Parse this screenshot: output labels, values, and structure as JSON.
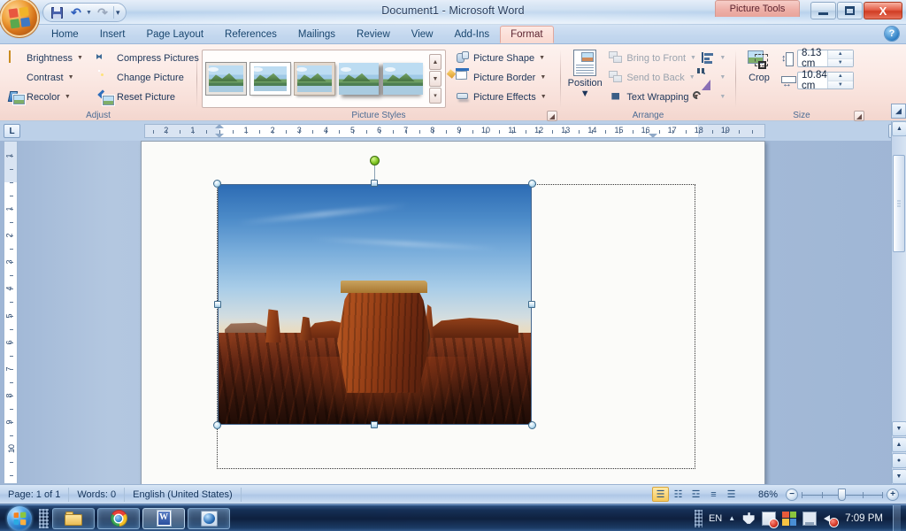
{
  "window": {
    "title": "Document1 - Microsoft Word",
    "contextual_tab_label": "Picture Tools",
    "minimize_label": "Minimize",
    "restore_label": "Restore",
    "close_label": "X",
    "help_label": "?"
  },
  "quick_access": {
    "office_button": "Office Button",
    "items": [
      {
        "name": "save",
        "label": "Save"
      },
      {
        "name": "undo",
        "label": "Undo"
      },
      {
        "name": "redo",
        "label": "Redo"
      },
      {
        "name": "customize",
        "label": "Customize Quick Access Toolbar"
      }
    ]
  },
  "tabs": [
    {
      "label": "Home",
      "active": false
    },
    {
      "label": "Insert",
      "active": false
    },
    {
      "label": "Page Layout",
      "active": false
    },
    {
      "label": "References",
      "active": false
    },
    {
      "label": "Mailings",
      "active": false
    },
    {
      "label": "Review",
      "active": false
    },
    {
      "label": "View",
      "active": false
    },
    {
      "label": "Add-Ins",
      "active": false
    },
    {
      "label": "Format",
      "active": true
    }
  ],
  "ribbon": {
    "groups": [
      {
        "name": "Adjust",
        "label": "Adjust",
        "commands": [
          {
            "label": "Brightness",
            "icon": "brightness-icon",
            "dropdown": true,
            "disabled": false
          },
          {
            "label": "Contrast",
            "icon": "contrast-icon",
            "dropdown": true,
            "disabled": false
          },
          {
            "label": "Recolor",
            "icon": "recolor-icon",
            "dropdown": true,
            "disabled": false
          },
          {
            "label": "Compress Pictures",
            "icon": "compress-pictures-icon",
            "dropdown": false,
            "disabled": false
          },
          {
            "label": "Change Picture",
            "icon": "change-picture-icon",
            "dropdown": false,
            "disabled": false
          },
          {
            "label": "Reset Picture",
            "icon": "reset-picture-icon",
            "dropdown": false,
            "disabled": false
          }
        ]
      },
      {
        "name": "Picture Styles",
        "label": "Picture Styles",
        "gallery_items": [
          "Simple Frame, White",
          "Beveled Matte, White",
          "Metal Frame",
          "Drop Shadow Rectangle",
          "Reflected Rounded Rectangle"
        ],
        "commands": [
          {
            "label": "Picture Shape",
            "icon": "picture-shape-icon",
            "dropdown": true
          },
          {
            "label": "Picture Border",
            "icon": "picture-border-icon",
            "dropdown": true
          },
          {
            "label": "Picture Effects",
            "icon": "picture-effects-icon",
            "dropdown": true
          }
        ]
      },
      {
        "name": "Arrange",
        "label": "Arrange",
        "position_label": "Position",
        "commands": [
          {
            "label": "Bring to Front",
            "icon": "bring-to-front-icon",
            "dropdown": true,
            "disabled": true
          },
          {
            "label": "Send to Back",
            "icon": "send-to-back-icon",
            "dropdown": true,
            "disabled": true
          },
          {
            "label": "Text Wrapping",
            "icon": "text-wrapping-icon",
            "dropdown": true,
            "disabled": false
          },
          {
            "label": "Align",
            "icon": "align-icon",
            "dropdown": true,
            "disabled": true
          },
          {
            "label": "Group",
            "icon": "group-icon",
            "dropdown": true,
            "disabled": true
          },
          {
            "label": "Rotate",
            "icon": "rotate-icon",
            "dropdown": true,
            "disabled": true
          }
        ]
      },
      {
        "name": "Size",
        "label": "Size",
        "crop_label": "Crop",
        "height": "8.13 cm",
        "width": "10.84 cm"
      }
    ]
  },
  "ruler": {
    "tab_selector": "L",
    "horizontal_labels": [
      "2",
      "1",
      "1",
      "2",
      "3",
      "4",
      "5",
      "6",
      "7",
      "8",
      "9",
      "10",
      "11",
      "12",
      "13",
      "14",
      "15",
      "16",
      "17",
      "18",
      "19"
    ],
    "vertical_labels": [
      "1",
      "1",
      "2",
      "3",
      "4",
      "5",
      "6",
      "7",
      "8",
      "9",
      "10"
    ]
  },
  "document": {
    "picture": {
      "name": "Monument Valley desert butte at sunset",
      "selected": true,
      "handles": [
        "top-left",
        "top-center",
        "top-right",
        "middle-left",
        "middle-right",
        "bottom-left",
        "bottom-center",
        "bottom-right"
      ],
      "rotation_handle": "rotation-handle"
    }
  },
  "status_bar": {
    "page": "Page: 1 of 1",
    "words": "Words: 0",
    "language": "English (United States)",
    "view_buttons": [
      {
        "name": "print-layout",
        "glyph": "☰",
        "active": true
      },
      {
        "name": "full-screen-reading",
        "glyph": "☷",
        "active": false
      },
      {
        "name": "web-layout",
        "glyph": "☲",
        "active": false
      },
      {
        "name": "outline",
        "glyph": "≡",
        "active": false
      },
      {
        "name": "draft",
        "glyph": "☰",
        "active": false
      }
    ],
    "zoom_percent": "86%",
    "zoom_out_label": "−",
    "zoom_in_label": "+"
  },
  "taskbar": {
    "start_label": "Start",
    "items": [
      {
        "name": "windows-explorer",
        "label": "Windows Explorer",
        "state": "open"
      },
      {
        "name": "google-chrome",
        "label": "Google Chrome",
        "state": "open"
      },
      {
        "name": "microsoft-word",
        "label": "Microsoft Word",
        "state": "active"
      },
      {
        "name": "media-player",
        "label": "Media Player",
        "state": "open"
      }
    ],
    "tray": {
      "language": "EN",
      "icons": [
        "plug-icon",
        "flag-alert-icon",
        "network-icon",
        "monitor-icon",
        "volume-muted-icon"
      ],
      "clock": "7:09 PM"
    }
  },
  "colors": {
    "contextual_tab": "#f9ddd6",
    "accent_blue": "#2f6fbb",
    "close_red": "#cf3d23",
    "selection_handle": "#6fa7c9",
    "rotation_handle": "#7ec422"
  }
}
